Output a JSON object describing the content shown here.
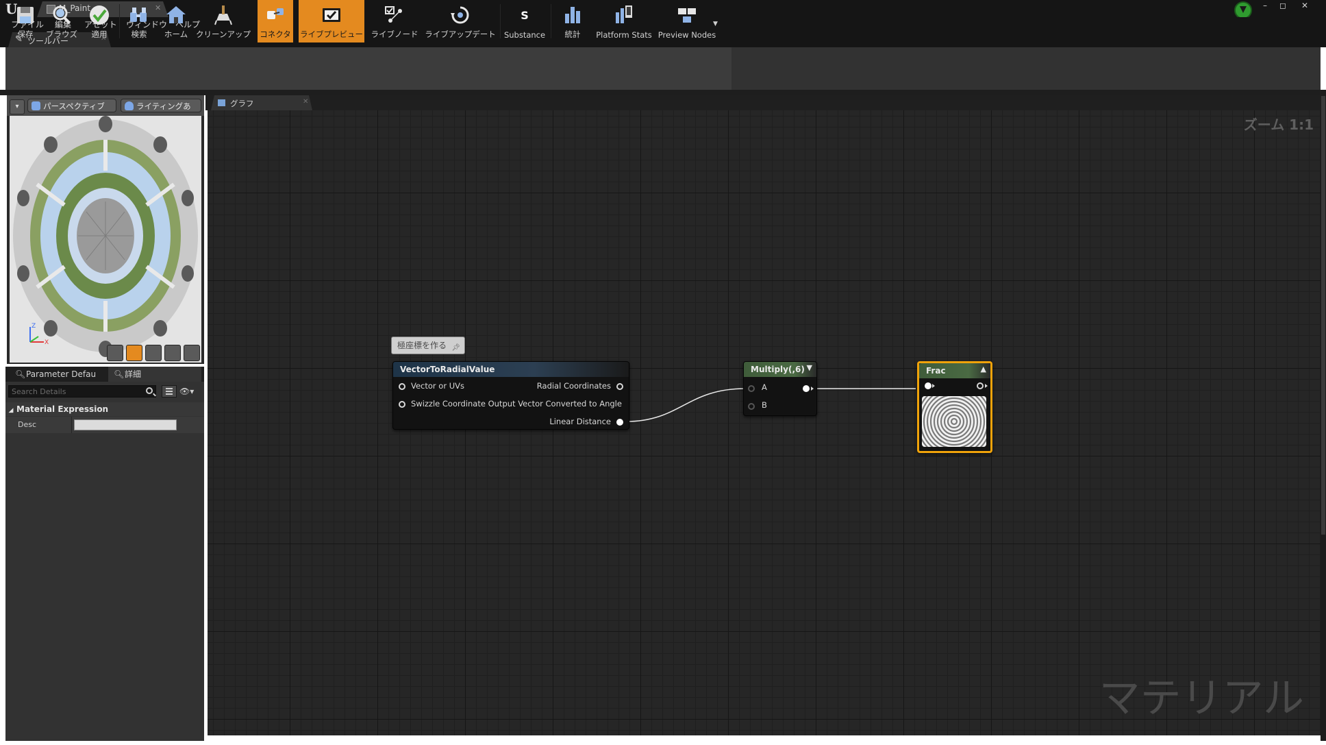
{
  "title_bar": {
    "doc_tab": "M_Paint",
    "window_buttons": [
      "–",
      "◻",
      "✕"
    ]
  },
  "menu": [
    "ファイル",
    "編集",
    "アセット",
    "ウィンドウ",
    "ヘルプ"
  ],
  "toolbar_tab": "ツールバー",
  "toolbar": [
    {
      "label": "保存",
      "icon": "save-icon"
    },
    {
      "label": "ブラウズ",
      "icon": "browse-icon"
    },
    {
      "label": "適用",
      "icon": "apply-icon"
    },
    {
      "label": "検索",
      "icon": "search-icon"
    },
    {
      "label": "ホーム",
      "icon": "home-icon"
    },
    {
      "label": "クリーンアップ",
      "icon": "cleanup-icon"
    },
    {
      "label": "コネクタ",
      "icon": "connector-icon",
      "active": true
    },
    {
      "label": "ライブプレビュー",
      "icon": "live-preview-icon",
      "active": true
    },
    {
      "label": "ライブノード",
      "icon": "live-nodes-icon"
    },
    {
      "label": "ライブアップデート",
      "icon": "live-update-icon"
    },
    {
      "label": "Substance",
      "icon": "substance-icon"
    },
    {
      "label": "統計",
      "icon": "stats-icon"
    },
    {
      "label": "Platform Stats",
      "icon": "platform-stats-icon"
    },
    {
      "label": "Preview Nodes",
      "icon": "preview-nodes-icon"
    }
  ],
  "viewport": {
    "perspective": "パースペクティブ",
    "lighting": "ライティングあり"
  },
  "details": {
    "tabs": [
      "Parameter Defau",
      "詳細"
    ],
    "search_placeholder": "Search Details",
    "section": "Material Expression",
    "row_label": "Desc",
    "row_value": ""
  },
  "graph": {
    "tab": "グラフ",
    "zoom": "ズーム 1:1",
    "watermark": "マテリアル",
    "comment": "極座標を作る",
    "nodes": {
      "radial": {
        "title": "VectorToRadialValue",
        "inputs": [
          "Vector or UVs",
          "Swizzle Coordinate Output Vector Converted to Angle"
        ],
        "outputs": [
          "Radial Coordinates",
          "Linear Distance"
        ]
      },
      "multiply": {
        "title": "Multiply(,6)",
        "inputs": [
          "A",
          "B"
        ]
      },
      "frac": {
        "title": "Frac"
      }
    }
  },
  "colors": {
    "accent": "#e48a1f",
    "radial_header": "#1e3448",
    "math_header": "#3f5c3a",
    "selected_outline": "#f0a30a"
  }
}
